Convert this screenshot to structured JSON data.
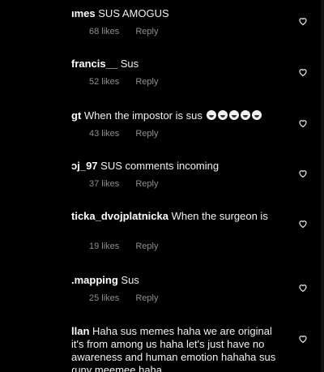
{
  "comments": [
    {
      "username": "ımes",
      "text": "SUS AMOGUS",
      "likes": "68 likes",
      "reply": "Reply"
    },
    {
      "username": "francis__",
      "text": "Sus",
      "likes": "52 likes",
      "reply": "Reply"
    },
    {
      "username": "gt",
      "text": "When the impostor is sus",
      "likes": "43 likes",
      "reply": "Reply"
    },
    {
      "username": "ɔj_97",
      "text": "SUS comments incoming",
      "likes": "37 likes",
      "reply": "Reply"
    },
    {
      "username": "ticka_dvojplatnicka",
      "text": "When the surgeon is",
      "likes": "19 likes",
      "reply": "Reply"
    },
    {
      "username": ".mapping",
      "text": "Sus",
      "likes": "25 likes",
      "reply": "Reply"
    },
    {
      "username": "llan",
      "lines": [
        "Haha sus memes haha we are original",
        "it's from among us haha let's just have no",
        "awareness and human emotion hahaha sus",
        "ɾuny meemee haha"
      ]
    }
  ],
  "colors": {
    "background": "#000000",
    "text": "#ffffff",
    "meta": "#8e8e8e"
  },
  "icons": {
    "like": "heart-outline-icon",
    "emoji": "laughing-face-icon"
  }
}
